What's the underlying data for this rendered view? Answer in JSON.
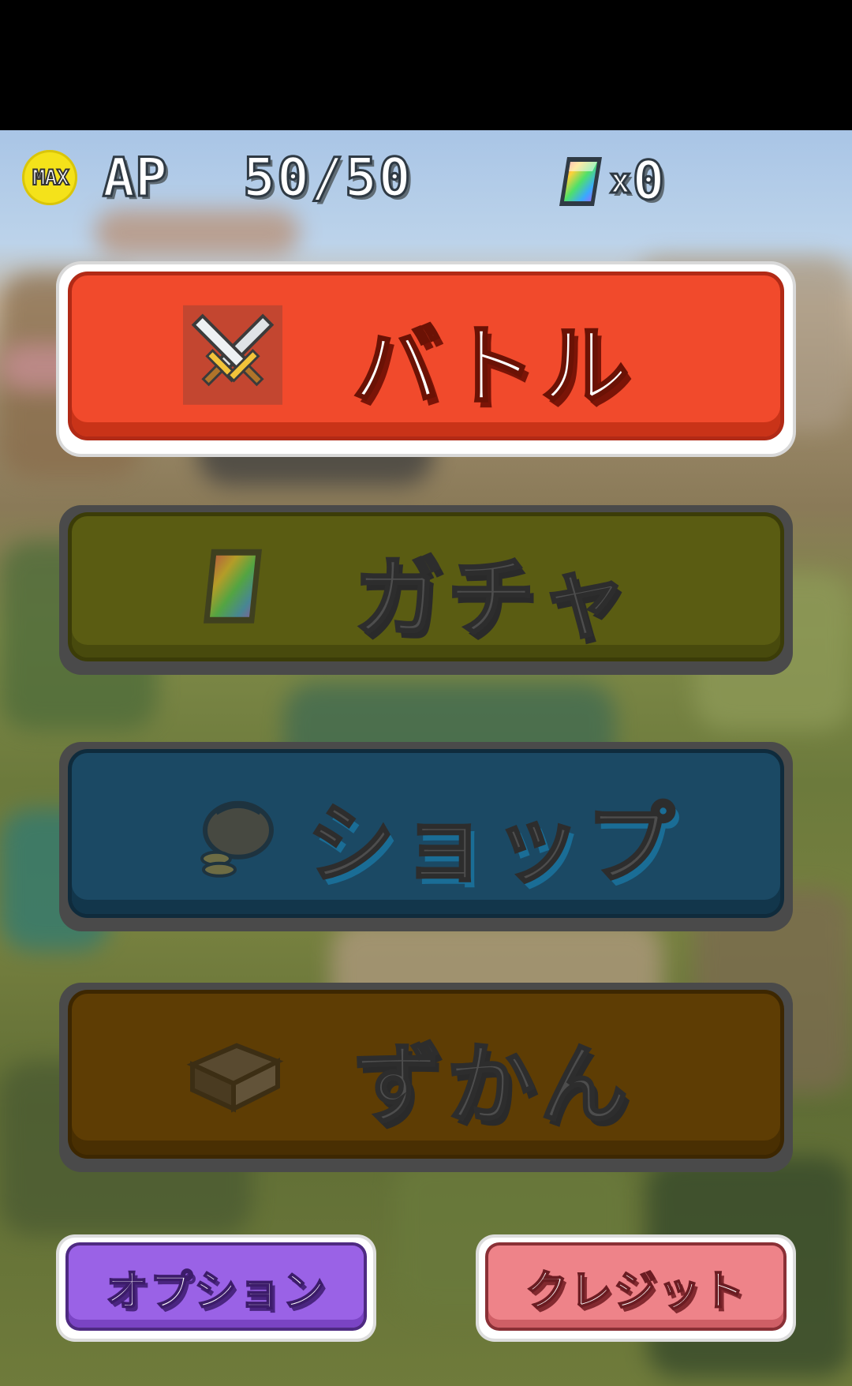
{
  "hud": {
    "max_badge": "MAX",
    "ap_label": "AP",
    "ap_value": "50/50",
    "gem_multiplier": "x",
    "gem_count": "0"
  },
  "menu": {
    "battle": {
      "label": "バトル",
      "icon": "crossed-swords-icon"
    },
    "gacha": {
      "label": "ガチャ",
      "icon": "rainbow-gem-icon"
    },
    "shop": {
      "label": "ショップ",
      "icon": "money-bag-icon"
    },
    "zukan": {
      "label": "ずかん",
      "icon": "book-icon"
    }
  },
  "footer": {
    "options_label": "オプション",
    "credits_label": "クレジット"
  },
  "colors": {
    "battle": "#f14a2c",
    "gacha_disabled": "#5a5c12",
    "shop_disabled": "#1b4964",
    "zukan_disabled": "#5e3d04",
    "options": "#9a62e6",
    "credits": "#ee8389",
    "max_badge": "#f4e21a"
  }
}
